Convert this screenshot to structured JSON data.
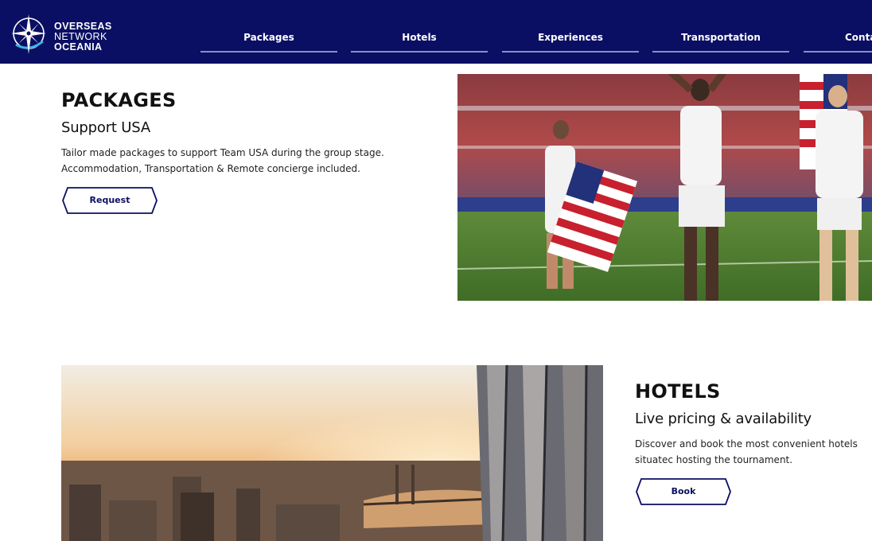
{
  "brand": {
    "line1": "OVERSEAS",
    "line2": "NETWORK",
    "line3": "OCEANIA",
    "icon": "compass-star-icon",
    "color_bg": "#0b0f63"
  },
  "nav": {
    "items": [
      {
        "label": "Packages"
      },
      {
        "label": "Hotels"
      },
      {
        "label": "Experiences"
      },
      {
        "label": "Transportation"
      },
      {
        "label": "Conta"
      }
    ]
  },
  "packages": {
    "title": "PACKAGES",
    "subtitle": "Support USA",
    "description": "Tailor made packages to support Team USA during the group stage. Accommodation, Transportation & Remote concierge included.",
    "button_label": "Request"
  },
  "hotels": {
    "title": "HOTELS",
    "subtitle": "Live pricing & availability",
    "description": "Discover and book the most convenient hotels situatec hosting the tournament.",
    "button_label": "Book"
  },
  "photos": {
    "packages_photo": "soccer-team-celebration-photo",
    "hotels_photo": "city-skyline-sunset-photo"
  }
}
